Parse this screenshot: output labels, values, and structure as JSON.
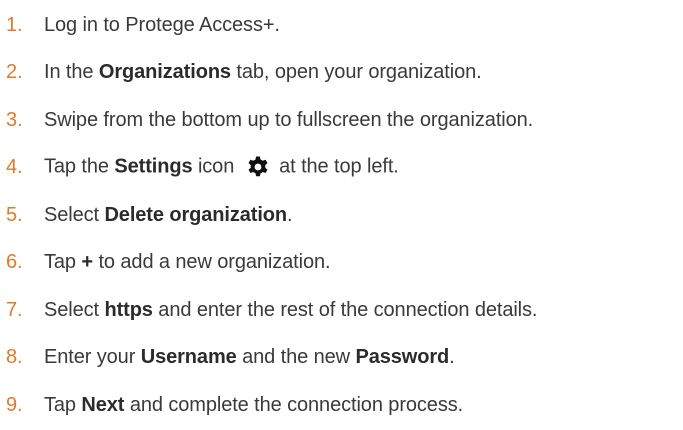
{
  "steps": [
    {
      "num": "1.",
      "parts": [
        "Log in to Protege Access+."
      ]
    },
    {
      "num": "2.",
      "parts": [
        "In the ",
        "Organizations",
        " tab, open your organization."
      ]
    },
    {
      "num": "3.",
      "parts": [
        "Swipe from the bottom up to fullscreen the organization."
      ]
    },
    {
      "num": "4.",
      "parts": [
        "Tap the ",
        "Settings",
        " icon ",
        " at the top left."
      ],
      "icon": "gear-icon"
    },
    {
      "num": "5.",
      "parts": [
        "Select ",
        "Delete organization",
        "."
      ]
    },
    {
      "num": "6.",
      "parts": [
        "Tap ",
        "+",
        " to add a new organization."
      ]
    },
    {
      "num": "7.",
      "parts": [
        "Select ",
        "https",
        " and enter the rest of the connection details."
      ]
    },
    {
      "num": "8.",
      "parts": [
        "Enter your ",
        "Username",
        " and the new ",
        "Password",
        "."
      ]
    },
    {
      "num": "9.",
      "parts": [
        "Tap ",
        "Next",
        " and complete the connection process."
      ]
    }
  ],
  "colors": {
    "number": "#e07a2b",
    "text": "#3a3a3a"
  }
}
